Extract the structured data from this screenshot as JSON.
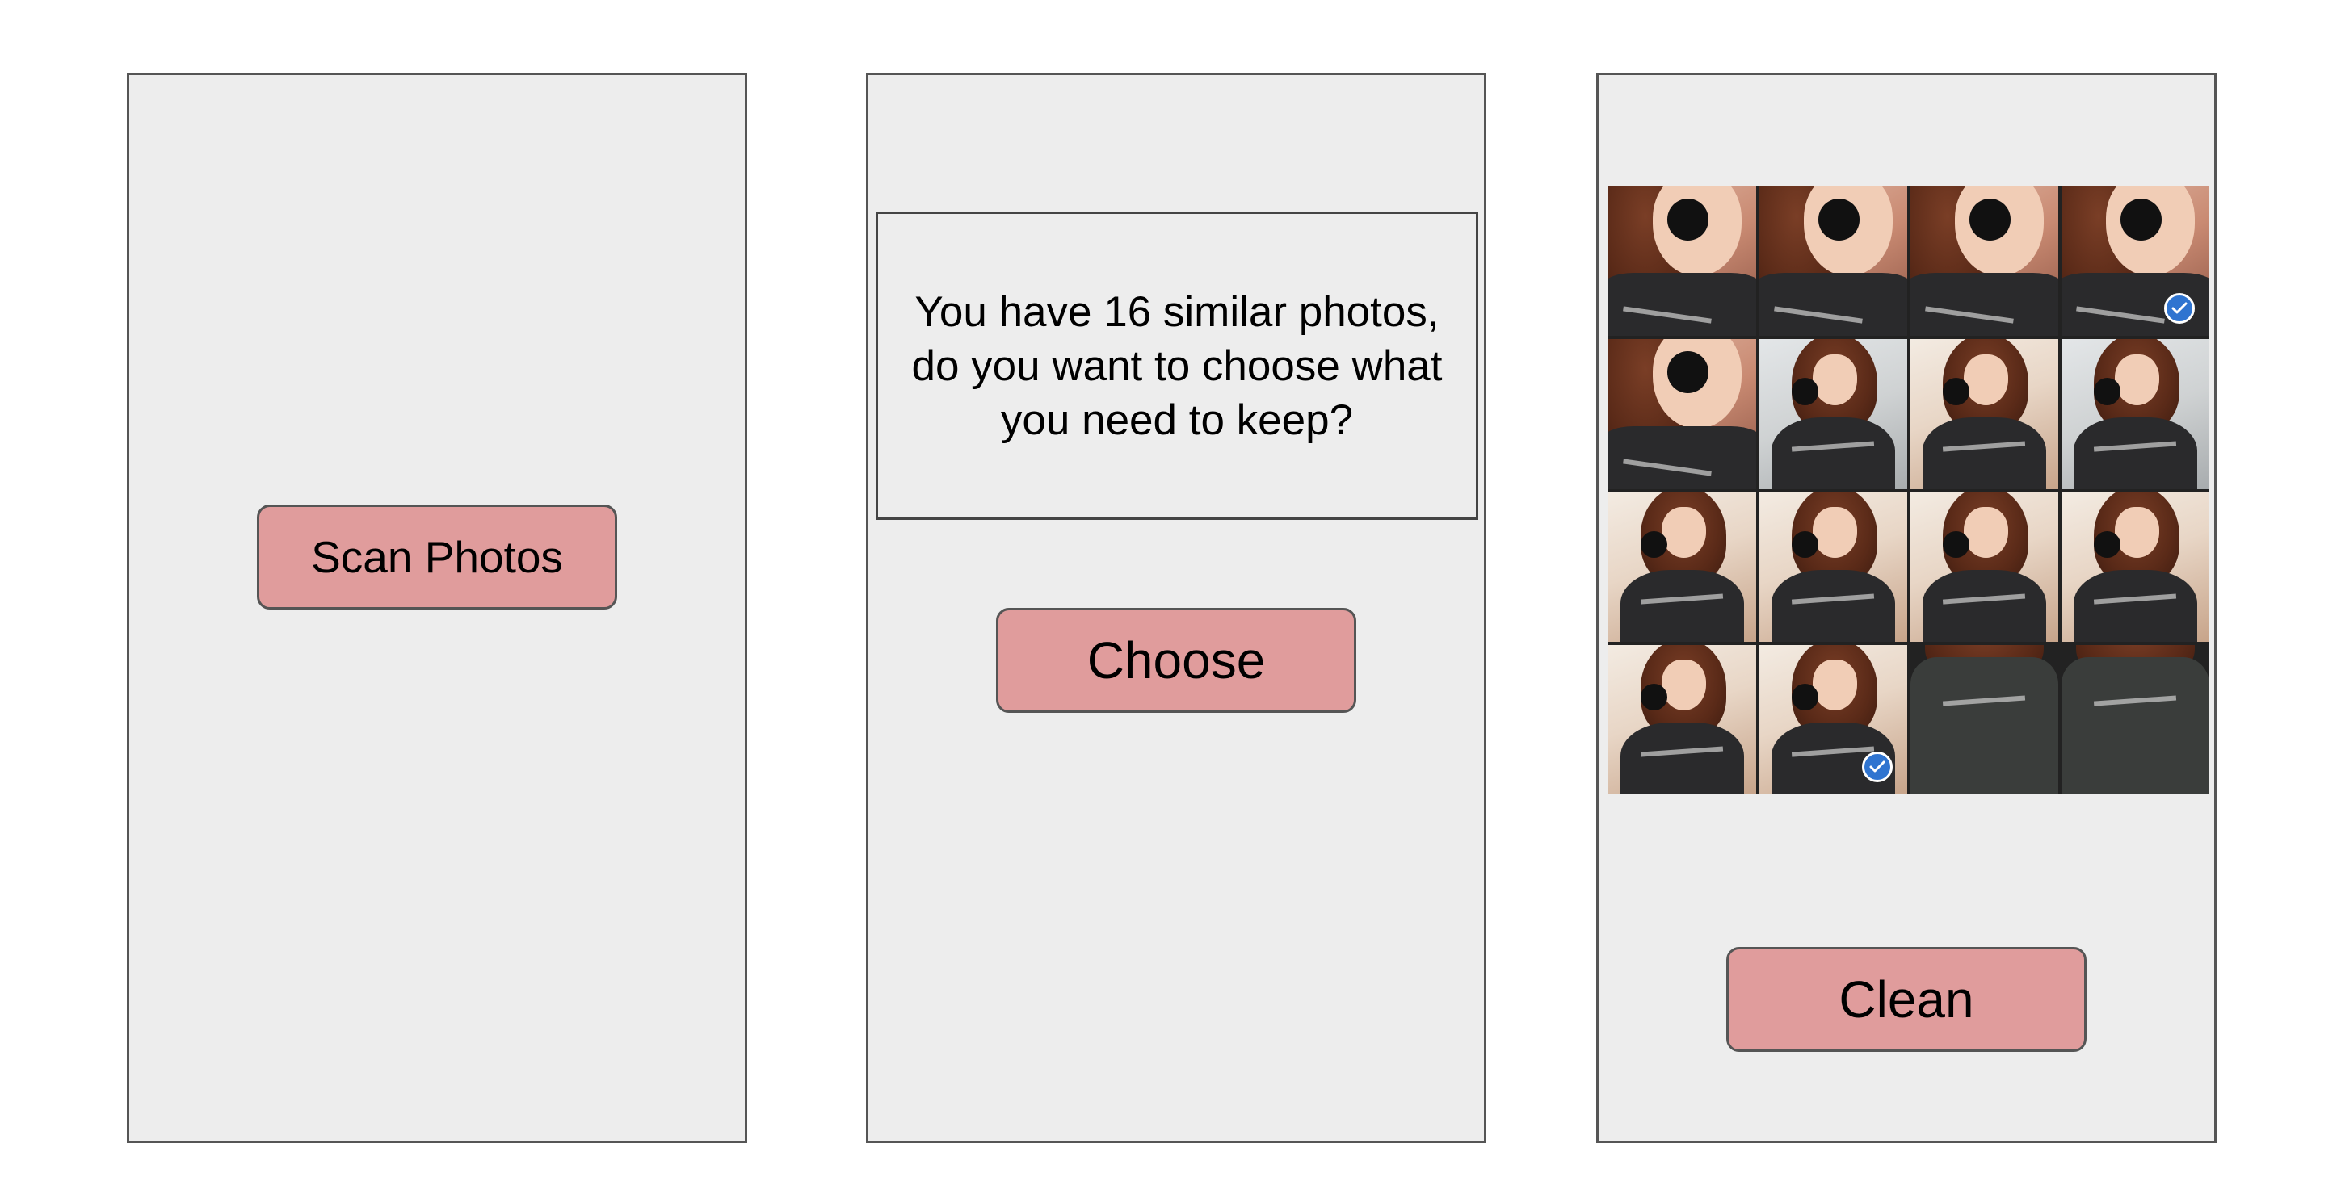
{
  "screens": {
    "scan": {
      "button_label": "Scan Photos"
    },
    "prompt": {
      "message": "You have 16 similar photos, do you want to choose what you need to keep?",
      "button_label": "Choose"
    },
    "selection": {
      "photos": [
        {
          "variant": "close",
          "selected": false
        },
        {
          "variant": "close",
          "selected": false
        },
        {
          "variant": "close",
          "selected": false
        },
        {
          "variant": "close",
          "selected": true
        },
        {
          "variant": "close",
          "selected": false
        },
        {
          "variant": "cool",
          "selected": false
        },
        {
          "variant": "warm",
          "selected": false
        },
        {
          "variant": "cool",
          "selected": false
        },
        {
          "variant": "warm",
          "selected": false
        },
        {
          "variant": "warm",
          "selected": false
        },
        {
          "variant": "warm",
          "selected": false
        },
        {
          "variant": "warm",
          "selected": false
        },
        {
          "variant": "warm",
          "selected": false
        },
        {
          "variant": "warm",
          "selected": true
        },
        {
          "variant": "bodyonly",
          "selected": false
        },
        {
          "variant": "bodyonly",
          "selected": false
        }
      ],
      "check_icon": "checkmark-icon",
      "button_label": "Clean"
    }
  },
  "colors": {
    "button_fill": "#e09c9c",
    "screen_bg": "#ededed",
    "check_badge": "#2f74d0"
  }
}
